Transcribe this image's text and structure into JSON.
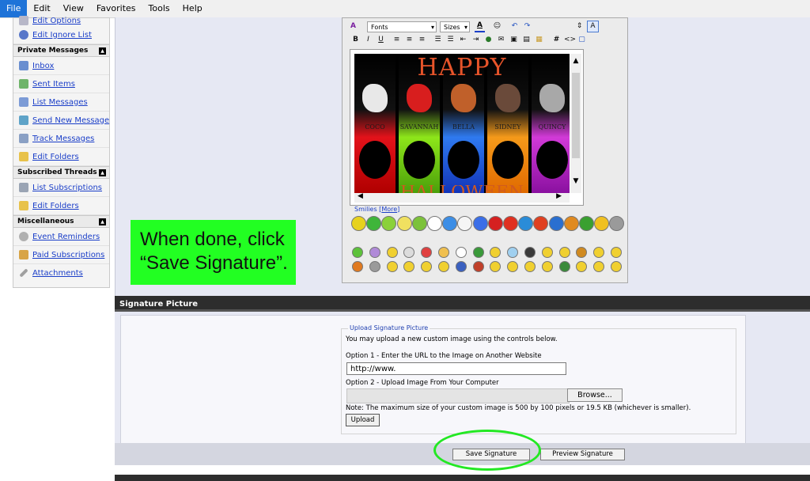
{
  "menu": [
    "File",
    "Edit",
    "View",
    "Favorites",
    "Tools",
    "Help"
  ],
  "sidebar": {
    "top_items": [
      "Edit Options",
      "Edit Ignore List"
    ],
    "sections": [
      {
        "title": "Private Messages",
        "items": [
          "Inbox",
          "Sent Items",
          "List Messages",
          "Send New Message",
          "Track Messages",
          "Edit Folders"
        ]
      },
      {
        "title": "Subscribed Threads",
        "items": [
          "List Subscriptions",
          "Edit Folders"
        ]
      },
      {
        "title": "Miscellaneous",
        "items": [
          "Event Reminders",
          "Paid Subscriptions",
          "Attachments"
        ]
      }
    ]
  },
  "editor": {
    "font_select": "Fonts",
    "size_select": "Sizes",
    "image": {
      "happy": "HAPPY",
      "halloween": "HALLOWEEN",
      "names": [
        "COCO",
        "SAVANNAH",
        "BELLA",
        "SIDNEY",
        "QUINCY"
      ]
    },
    "smilies_label": "Smilies",
    "more_label": "More"
  },
  "callout": {
    "line1": "When done, click",
    "line2": "“Save Signature”."
  },
  "signature_picture": {
    "header": "Signature Picture",
    "legend": "Upload Signature Picture",
    "intro": "You may upload a new custom image using the controls below.",
    "option1": "Option 1 - Enter the URL to the Image on Another Website",
    "url_value": "http://www.",
    "option2": "Option 2 - Upload Image From Your Computer",
    "browse": "Browse...",
    "note": "Note: The maximum size of your custom image is 500 by 100 pixels or 19.5 KB (whichever is smaller).",
    "upload": "Upload"
  },
  "buttons": {
    "save": "Save Signature",
    "preview": "Preview Signature"
  },
  "colors": {
    "accent": "#1e73d8",
    "callout": "#22ff22",
    "highlight_oval": "#23e823",
    "link": "#1a3ec8"
  }
}
